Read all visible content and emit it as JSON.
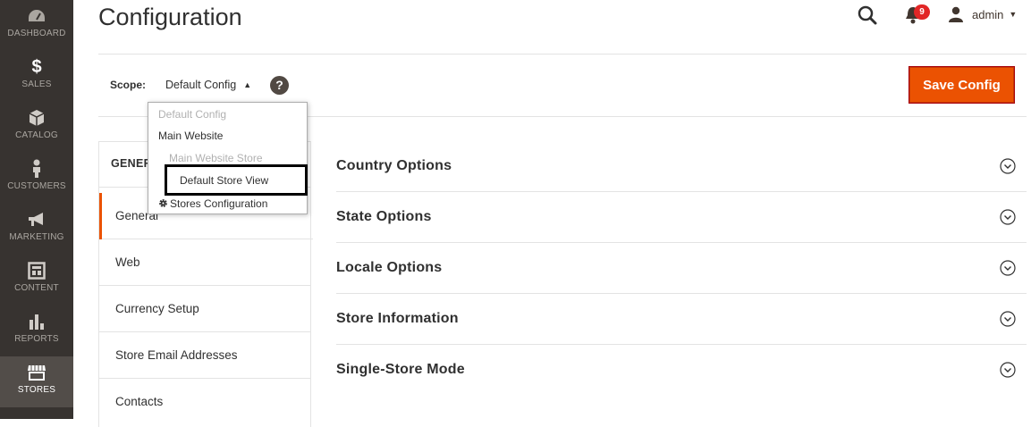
{
  "sidebar": {
    "items": [
      {
        "label": "Dashboard",
        "icon": "dashboard-icon"
      },
      {
        "label": "Sales",
        "icon": "dollar-icon"
      },
      {
        "label": "Catalog",
        "icon": "cube-icon"
      },
      {
        "label": "Customers",
        "icon": "person-icon"
      },
      {
        "label": "Marketing",
        "icon": "megaphone-icon"
      },
      {
        "label": "Content",
        "icon": "layout-icon"
      },
      {
        "label": "Reports",
        "icon": "bar-chart-icon"
      },
      {
        "label": "Stores",
        "icon": "store-icon"
      }
    ],
    "active": "Stores"
  },
  "header": {
    "title": "Configuration",
    "notifications_count": "9",
    "user_name": "admin"
  },
  "scope": {
    "label": "Scope:",
    "current": "Default Config",
    "help": "?",
    "options": [
      {
        "label": "Default Config",
        "enabled": false
      },
      {
        "label": "Main Website",
        "enabled": true
      },
      {
        "label": "Main Website Store",
        "enabled": false
      },
      {
        "label": "Default Store View",
        "enabled": true,
        "highlighted": true
      },
      {
        "label": "Stores Configuration",
        "enabled": true
      }
    ]
  },
  "toolbar": {
    "save_label": "Save Config"
  },
  "tabs": {
    "group_title": "GENERAL",
    "items": [
      "General",
      "Web",
      "Currency Setup",
      "Store Email Addresses",
      "Contacts"
    ],
    "active": "General"
  },
  "sections": [
    "Country Options",
    "State Options",
    "Locale Options",
    "Store Information",
    "Single-Store Mode"
  ],
  "colors": {
    "accent": "#eb5202",
    "sidebar": "#373330",
    "badge": "#e22626"
  }
}
